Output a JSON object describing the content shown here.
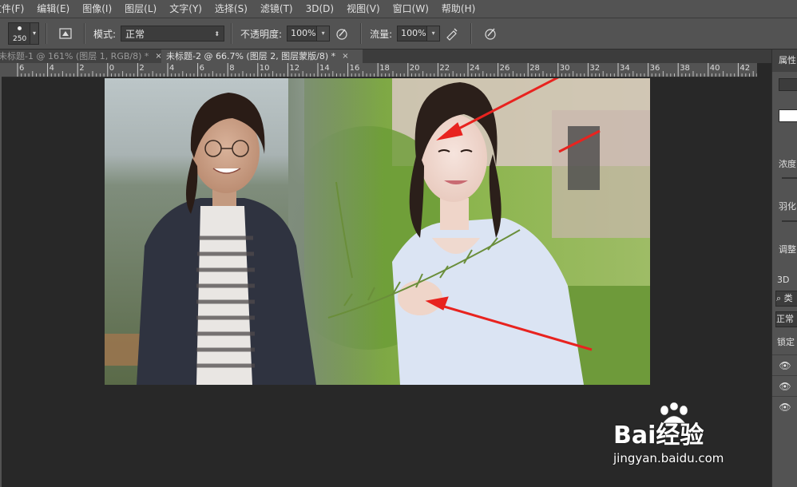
{
  "menubar": {
    "items": [
      "文件(F)",
      "编辑(E)",
      "图像(I)",
      "图层(L)",
      "文字(Y)",
      "选择(S)",
      "滤镜(T)",
      "3D(D)",
      "视图(V)",
      "窗口(W)",
      "帮助(H)"
    ]
  },
  "options": {
    "brush_size": "250",
    "mode_label": "模式:",
    "mode_value": "正常",
    "opacity_label": "不透明度:",
    "opacity_value": "100%",
    "flow_label": "流量:",
    "flow_value": "100%"
  },
  "tabs": [
    {
      "label": "未标题-1 @ 161% (图层 1, RGB/8) *",
      "close": "×"
    },
    {
      "label": "未标题-2 @ 66.7% (图层 2, 图层蒙版/8) *",
      "close": "×"
    }
  ],
  "ruler": {
    "labels": [
      "6",
      "4",
      "2",
      "0",
      "2",
      "4",
      "6",
      "8",
      "10",
      "12",
      "14",
      "16",
      "18",
      "20",
      "22",
      "24",
      "26",
      "28",
      "30",
      "32",
      "34",
      "36",
      "38",
      "40",
      "42"
    ]
  },
  "right_panel": {
    "properties_title": "属性",
    "density_label": "浓度",
    "feather_label": "羽化",
    "adjust_label": "调整",
    "tab_3d": "3D",
    "search_glyph": "⌕ 类",
    "blend_mode": "正常",
    "lock_label": "锁定",
    "eye_glyph": "👁"
  },
  "watermark": {
    "brand": "Bai经验",
    "url": "jingyan.baidu.com"
  },
  "colors": {
    "annotation_arrow": "#e8231f",
    "chrome": "#535353",
    "workspace": "#282828"
  }
}
